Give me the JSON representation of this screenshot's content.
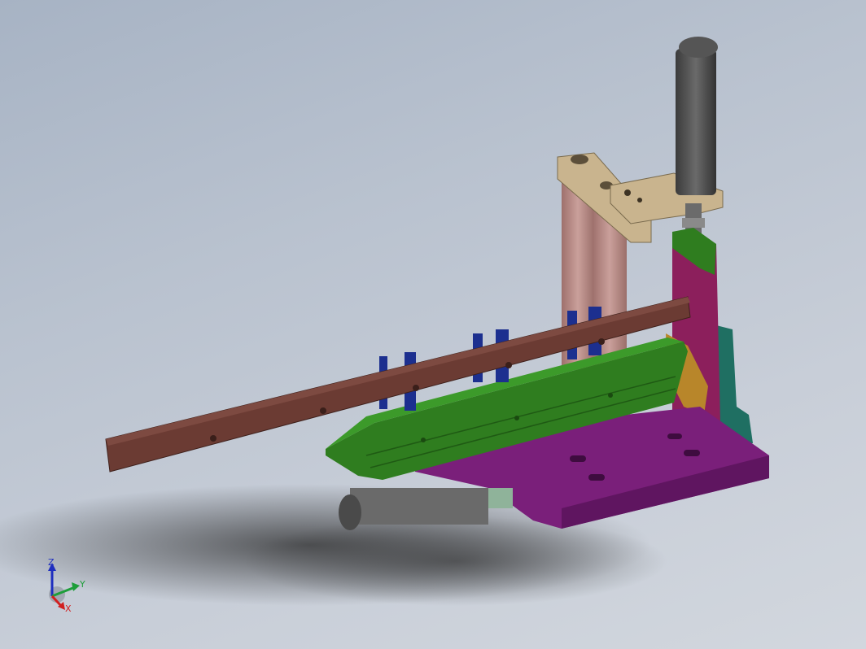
{
  "viewport": {
    "background_top": "#a7b3c4",
    "background_bottom": "#d2d7de"
  },
  "triad": {
    "z_label": "Z",
    "y_label": "Y",
    "x_label": "X",
    "z_color": "#1f2fbf",
    "y_color": "#1e9e3a",
    "x_color": "#d11f1f"
  },
  "model_colors": {
    "base_plate": "#7a1f7a",
    "rail": "#6b3b33",
    "green_guide": "#2f7d1f",
    "blue_tabs": "#1c2f8f",
    "posts": "#b98a86",
    "bracket": "#c9b48e",
    "cylinder": "#4a4a4a",
    "magenta_column": "#8c1f5c",
    "teal_blocks": "#1f6f62",
    "orange_block": "#b8862a"
  }
}
